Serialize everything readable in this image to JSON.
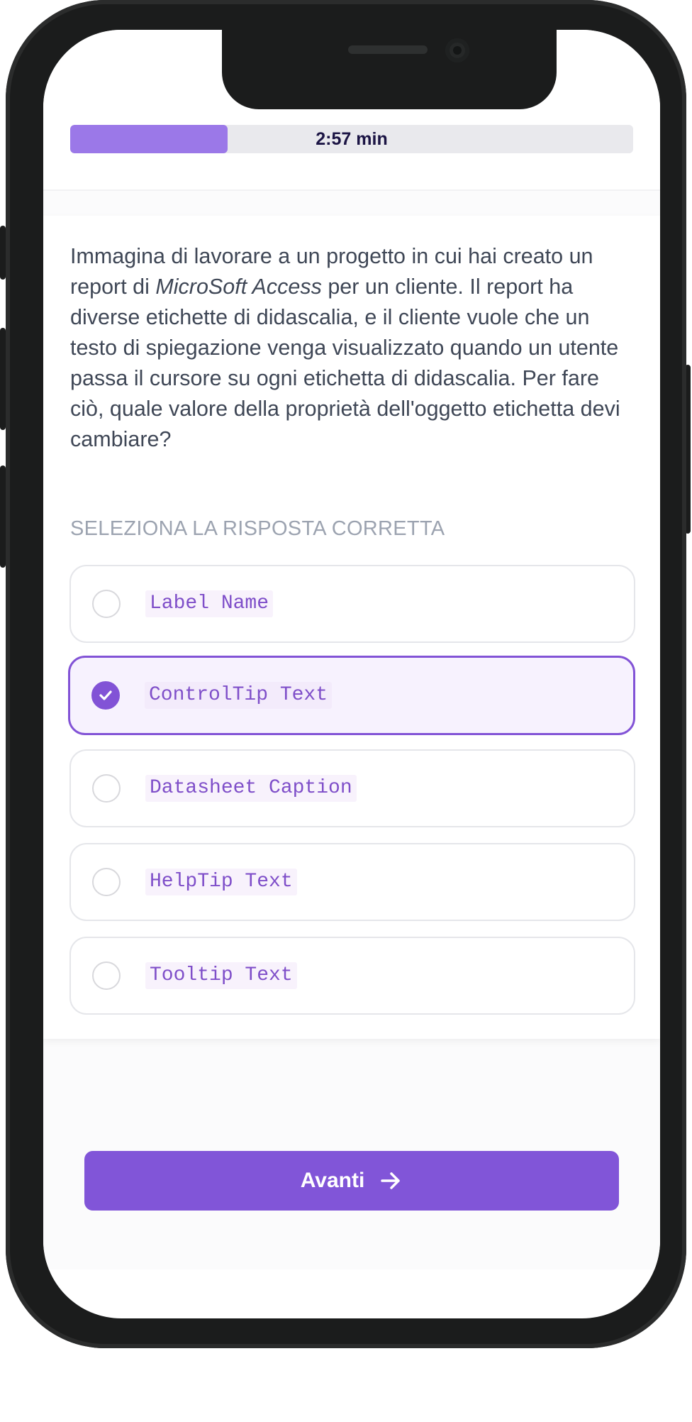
{
  "header": {
    "timer_text": "2:57 min",
    "progress_fraction": 0.28
  },
  "question": {
    "text_before": "Immagina di lavorare a un progetto in cui hai creato un report di ",
    "emphasis": "MicroSoft Access",
    "text_after": " per un cliente. Il report ha diverse etichette di didascalia, e il cliente vuole che un testo di spiegazione venga visualizzato quando un utente passa il cursore su ogni etichetta di didascalia. Per fare ciò, quale valore della proprietà dell'oggetto etichetta devi cambiare?"
  },
  "answers": {
    "instruction": "SELEZIONA LA RISPOSTA CORRETTA",
    "options": [
      {
        "label": "Label Name",
        "selected": false
      },
      {
        "label": "ControlTip Text",
        "selected": true
      },
      {
        "label": "Datasheet Caption",
        "selected": false
      },
      {
        "label": "HelpTip Text",
        "selected": false
      },
      {
        "label": "Tooltip Text",
        "selected": false
      }
    ]
  },
  "footer": {
    "next_label": "Avanti",
    "next_icon": "arrow-right-icon"
  },
  "colors": {
    "accent": "#8155d8",
    "progress_fill": "#9b78e8",
    "selected_bg": "#f7f2fe",
    "code_text": "#7f4fc9"
  }
}
